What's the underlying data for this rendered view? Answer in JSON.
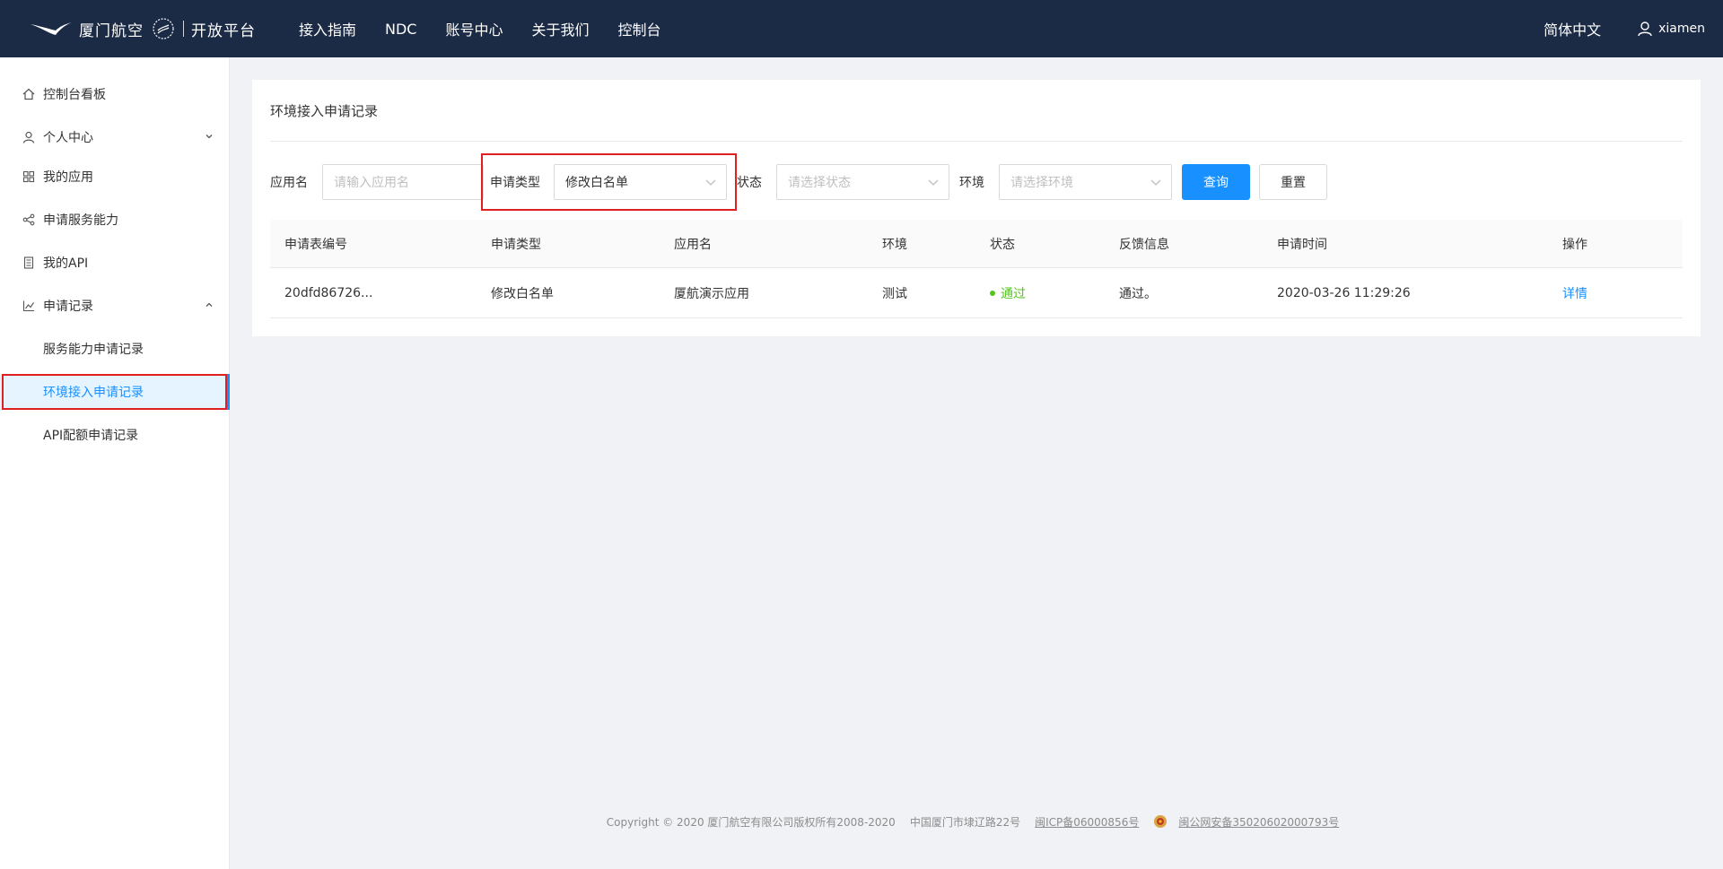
{
  "header": {
    "brand_name": "厦门航空",
    "platform": "开放平台",
    "nav": [
      "接入指南",
      "NDC",
      "账号中心",
      "关于我们",
      "控制台"
    ],
    "language": "简体中文",
    "username": "xiamen"
  },
  "sidebar": {
    "items": [
      {
        "label": "控制台看板",
        "icon": "home-icon"
      },
      {
        "label": "个人中心",
        "icon": "user-icon"
      },
      {
        "label": "我的应用",
        "icon": "grid-icon"
      },
      {
        "label": "申请服务能力",
        "icon": "share-icon"
      },
      {
        "label": "我的API",
        "icon": "document-icon"
      },
      {
        "label": "申请记录",
        "icon": "chart-icon"
      }
    ],
    "subitems": [
      "服务能力申请记录",
      "环境接入申请记录",
      "API配额申请记录"
    ],
    "active_subitem": "环境接入申请记录"
  },
  "page": {
    "title": "环境接入申请记录"
  },
  "filters": {
    "app_name_label": "应用名",
    "app_name_placeholder": "请输入应用名",
    "type_label": "申请类型",
    "type_value": "修改白名单",
    "status_label": "状态",
    "status_placeholder": "请选择状态",
    "env_label": "环境",
    "env_placeholder": "请选择环境",
    "query_button": "查询",
    "reset_button": "重置"
  },
  "table": {
    "columns": [
      "申请表编号",
      "申请类型",
      "应用名",
      "环境",
      "状态",
      "反馈信息",
      "申请时间",
      "操作"
    ],
    "rows": [
      {
        "id": "20dfd86726...",
        "type": "修改白名单",
        "app": "厦航演示应用",
        "env": "测试",
        "status": "通过",
        "feedback": "通过。",
        "time": "2020-03-26 11:29:26",
        "action": "详情"
      }
    ]
  },
  "footer": {
    "copyright": "Copyright © 2020 厦门航空有限公司版权所有2008-2020",
    "address": "中国厦门市埭辽路22号",
    "icp": "闽ICP备06000856号",
    "police": "闽公网安备35020602000793号"
  },
  "colors": {
    "topbar": "#1b2a45",
    "primary": "#1890ff",
    "success": "#52c41a",
    "highlight": "#e02020"
  }
}
